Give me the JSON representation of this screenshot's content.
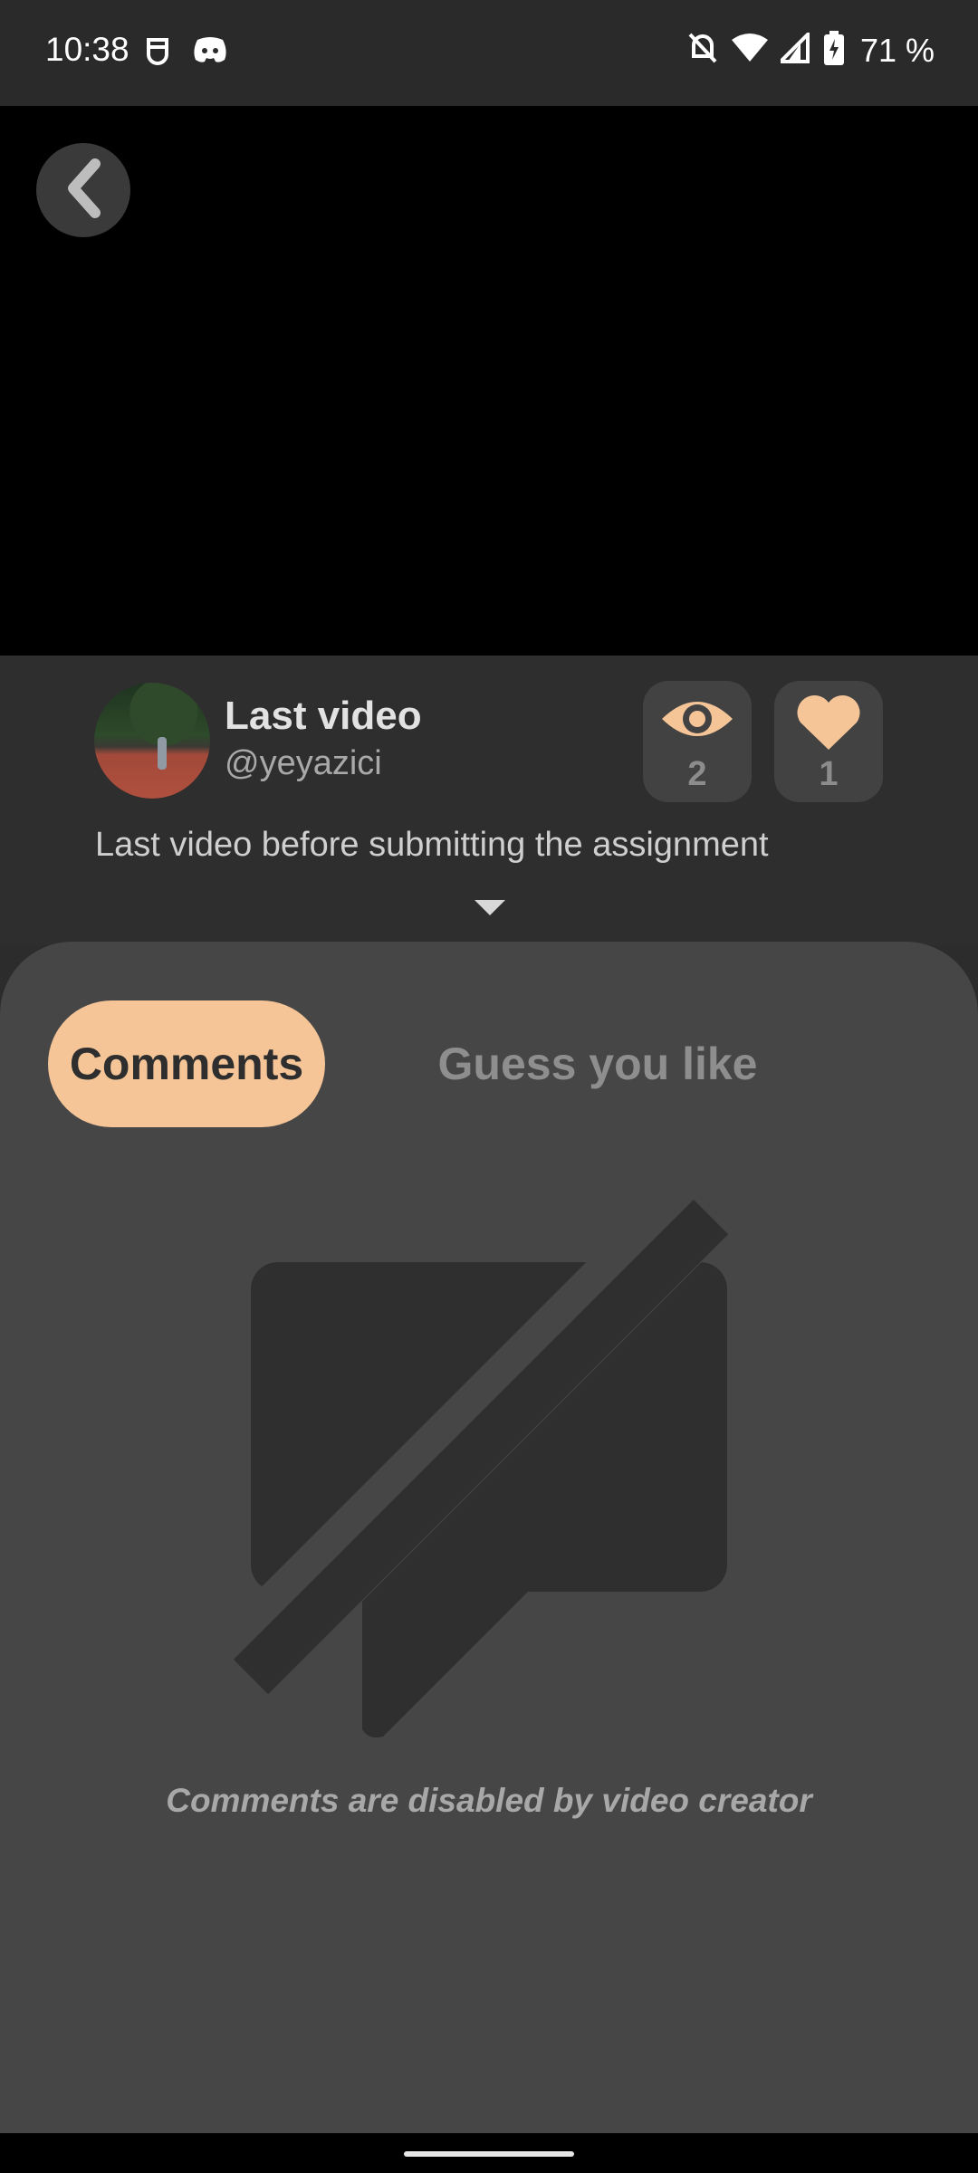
{
  "status_bar": {
    "time": "10:38",
    "left_icons": [
      "vpn-key-icon",
      "discord-icon"
    ],
    "right_icons": [
      "notifications-off-icon",
      "wifi-icon",
      "signal-icon",
      "battery-charging-icon"
    ],
    "battery": "71 %"
  },
  "video": {
    "back_icon": "chevron-left-icon",
    "title": "Last video",
    "handle": "@yeyazici",
    "description": "Last video before submitting the assignment",
    "views": "2",
    "likes": "1"
  },
  "tabs": [
    {
      "label": "Comments",
      "active": true
    },
    {
      "label": "Guess you like",
      "active": false
    }
  ],
  "comments": {
    "empty_icon": "comments-disabled-icon",
    "message": "Comments are disabled by video creator"
  },
  "colors": {
    "accent": "#f5c598",
    "panel": "#464646",
    "background": "#2e2e2e"
  }
}
